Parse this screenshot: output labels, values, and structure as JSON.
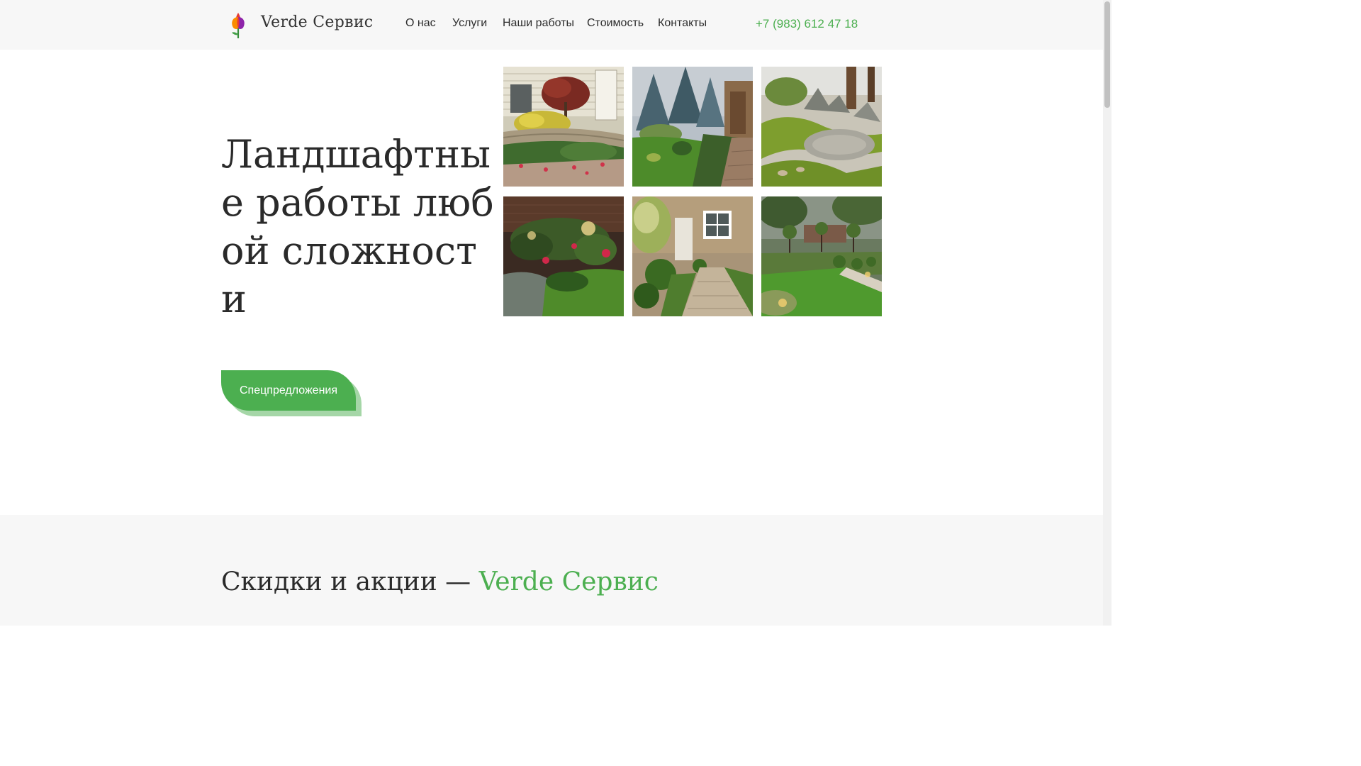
{
  "header": {
    "brand": "Verde Сервис",
    "nav": [
      {
        "label": "О нас"
      },
      {
        "label": "Услуги"
      },
      {
        "label": "Наши работы"
      },
      {
        "label": "Стоимость"
      },
      {
        "label": "Контакты"
      }
    ],
    "phone": "+7 (983) 612 47 18"
  },
  "hero": {
    "title": "Ландшафтные работы любой сложности",
    "cta_label": "Спецпредложения"
  },
  "gallery": {
    "photos": [
      {
        "subject": "garden-house-photo"
      },
      {
        "subject": "conifer-garden-photo"
      },
      {
        "subject": "zen-rock-garden-photo"
      },
      {
        "subject": "rose-border-photo"
      },
      {
        "subject": "boxwood-path-photo"
      },
      {
        "subject": "modern-lawn-photo"
      }
    ]
  },
  "promo": {
    "title_prefix": "Скидки и акции —",
    "title_accent": "Verde Сервис"
  },
  "colors": {
    "accent": "#4caf50",
    "accent_light": "#a5d6a7",
    "header_bg": "#f7f7f7",
    "text": "#2a2a2a"
  }
}
